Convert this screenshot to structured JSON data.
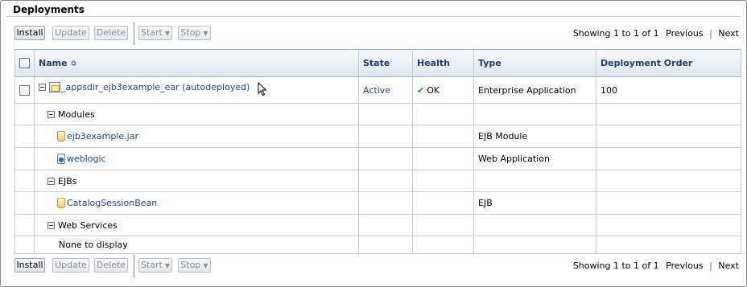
{
  "panel": {
    "title": "Deployments"
  },
  "toolbar": {
    "install": "Install",
    "update": "Update",
    "delete": "Delete",
    "start": "Start",
    "stop": "Stop"
  },
  "pager": {
    "showing": "Showing 1 to 1 of 1",
    "previous": "Previous",
    "next": "Next"
  },
  "table": {
    "headers": {
      "name": "Name",
      "state": "State",
      "health": "Health",
      "type": "Type",
      "order": "Deployment Order"
    },
    "app": {
      "name": "_appsdir_ejb3example_ear (autodeployed)",
      "state": "Active",
      "health": "OK",
      "type": "Enterprise Application",
      "order": "100"
    },
    "modules_label": "Modules",
    "modules": [
      {
        "name": "ejb3example.jar",
        "type": "EJB Module",
        "icon": "jar-icon"
      },
      {
        "name": "weblogic",
        "type": "Web Application",
        "icon": "web-module-icon"
      }
    ],
    "ejbs_label": "EJBs",
    "ejbs": [
      {
        "name": "CatalogSessionBean",
        "type": "EJB",
        "icon": "jar-icon"
      }
    ],
    "webservices_label": "Web Services",
    "none_text": "None to display"
  },
  "colors": {
    "header_text": "#1f3f7a",
    "link": "#1f3f9e",
    "ok_check": "#1e9a1e"
  }
}
